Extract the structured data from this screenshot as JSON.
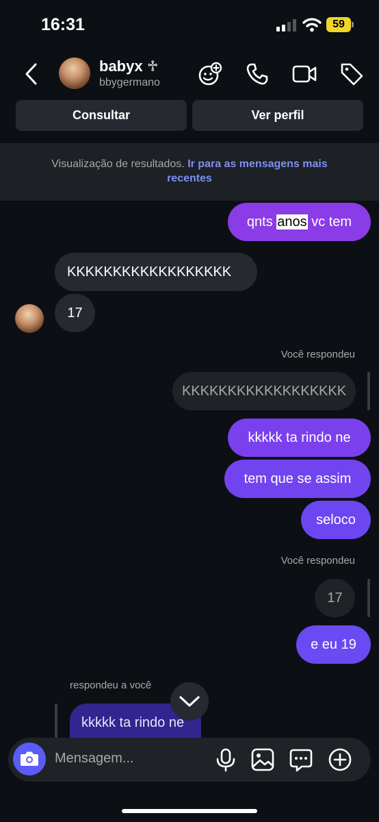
{
  "status_bar": {
    "time": "16:31",
    "battery": "59"
  },
  "header": {
    "name": "babyx ♱",
    "username": "bbygermano",
    "buttons": {
      "consult": "Consultar",
      "profile": "Ver perfil"
    },
    "icons": [
      "add-people-icon",
      "phone-icon",
      "video-icon",
      "tag-icon"
    ]
  },
  "banner": {
    "text": "Visualização de resultados. ",
    "link_line1": "Ir para as mensagens mais",
    "link_line2": "recentes"
  },
  "messages": {
    "m1_before": "qnts ",
    "m1_highlight": "anos",
    "m1_after": " vc tem",
    "m2": "KKKKKKKKKKKKKKKKKK",
    "m3": "17",
    "reply_label_1": "Você respondeu",
    "quoted_1": "KKKKKKKKKKKKKKKKKK",
    "m4": "kkkkk ta rindo ne",
    "m5": "tem que se assim",
    "m6": "seloco",
    "reply_label_2": "Você respondeu",
    "quoted_2": "17",
    "m7": "e eu 19",
    "reply_label_3": "respondeu a você",
    "quoted_3": "kkkkk ta rindo ne"
  },
  "composer": {
    "placeholder": "Mensagem..."
  },
  "colors": {
    "background": "#0c1014",
    "outgoing_purple": "#8a3ce6",
    "outgoing_violet": "#6a4af2",
    "incoming": "#262a30",
    "link": "#7f8ff5",
    "camera": "#5b5bf6"
  }
}
